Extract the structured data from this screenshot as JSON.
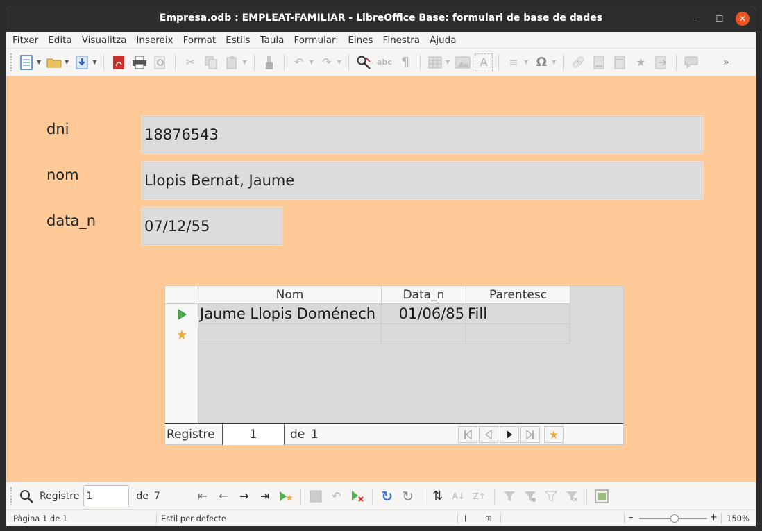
{
  "window": {
    "title": "Empresa.odb : EMPLEAT-FAMILIAR - LibreOffice Base: formulari de base de dades",
    "minimize": "–",
    "maximize": "☐",
    "close": "✕"
  },
  "menubar": {
    "items": [
      "Fitxer",
      "Edita",
      "Visualitza",
      "Insereix",
      "Format",
      "Estils",
      "Taula",
      "Formulari",
      "Eines",
      "Finestra",
      "Ajuda"
    ]
  },
  "toolbar": {
    "icons": [
      "new-document-icon",
      "open-folder-icon",
      "save-icon",
      "export-pdf-icon",
      "print-icon",
      "print-preview-icon",
      "cut-icon",
      "copy-icon",
      "paste-icon",
      "clone-formatting-icon",
      "undo-icon",
      "redo-icon",
      "spelling-icon",
      "autocorrect-icon",
      "formatting-marks-icon",
      "insert-table-icon",
      "insert-image-icon",
      "insert-textbox-icon",
      "insert-field-icon",
      "special-character-icon",
      "hyperlink-icon",
      "footnote-icon",
      "endnote-icon",
      "bookmark-icon",
      "cross-reference-icon",
      "comment-icon",
      "more-icon"
    ],
    "overflow": "»"
  },
  "form": {
    "fields": [
      {
        "label": "dni",
        "value": "18876543"
      },
      {
        "label": "nom",
        "value": "Llopis Bernat, Jaume"
      },
      {
        "label": "data_n",
        "value": "07/12/55"
      }
    ]
  },
  "subform": {
    "columns": [
      "Nom",
      "Data_n",
      "Parentesc"
    ],
    "rows": [
      {
        "nom": "Jaume Llopis Doménech",
        "data_n": "01/06/85",
        "parentesc": "Fill"
      }
    ],
    "nav": {
      "label": "Registre",
      "current": "1",
      "of_label": "de",
      "total": "1"
    },
    "colors": {
      "current_row": "#4eb04e",
      "new_row": "#e8a83a"
    }
  },
  "formnav": {
    "search_icon": "search-icon",
    "label": "Registre",
    "current": "1",
    "of_label": "de",
    "total": "7"
  },
  "statusbar": {
    "page": "Pàgina 1 de 1",
    "style": "Estil per defecte",
    "cursor": "I",
    "zoom": "150%",
    "zoom_minus": "–",
    "zoom_plus": "+"
  },
  "colors": {
    "document_bg": "#ffca98",
    "titlebar_bg": "#2d2d2d",
    "close_button": "#e95420",
    "field_bg": "#dcdcdc"
  }
}
